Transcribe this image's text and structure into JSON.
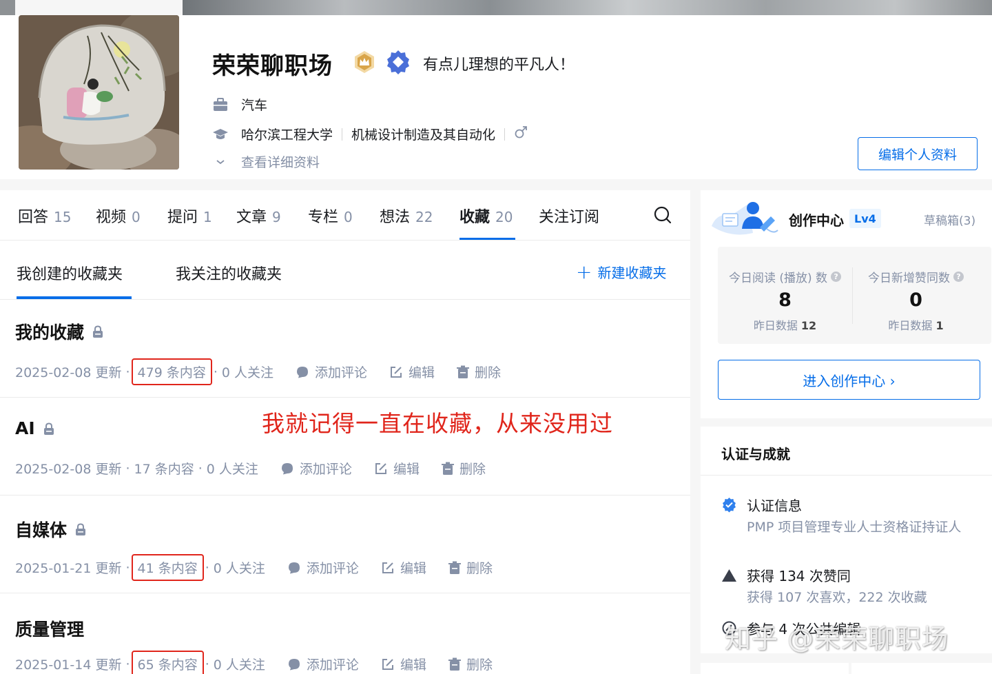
{
  "profile": {
    "name": "荣荣聊职场",
    "headline": "有点儿理想的平凡人！",
    "industry": "汽车",
    "school": "哈尔滨工程大学",
    "major": "机械设计制造及其自动化",
    "gender_icon": "male-icon",
    "detail_link": "查看详细资料",
    "edit_button": "编辑个人资料"
  },
  "tabs": [
    {
      "label": "回答",
      "count": "15"
    },
    {
      "label": "视频",
      "count": "0"
    },
    {
      "label": "提问",
      "count": "1"
    },
    {
      "label": "文章",
      "count": "9"
    },
    {
      "label": "专栏",
      "count": "0"
    },
    {
      "label": "想法",
      "count": "22"
    },
    {
      "label": "收藏",
      "count": "20",
      "active": true
    },
    {
      "label": "关注订阅",
      "count": ""
    }
  ],
  "subtabs": {
    "mine": "我创建的收藏夹",
    "followed": "我关注的收藏夹",
    "new_folder": "新建收藏夹"
  },
  "actions": {
    "comment": "添加评论",
    "edit": "编辑",
    "delete": "删除"
  },
  "collections": [
    {
      "title": "我的收藏",
      "updated": "2025-02-08 更新",
      "count": "479 条内容",
      "followers": "0 人关注",
      "locked": true,
      "highlighted": true
    },
    {
      "title": "AI",
      "updated": "2025-02-08 更新",
      "count": "17 条内容",
      "followers": "0 人关注",
      "locked": true,
      "highlighted": false
    },
    {
      "title": "自媒体",
      "updated": "2025-01-21 更新",
      "count": "41 条内容",
      "followers": "0 人关注",
      "locked": true,
      "highlighted": true
    },
    {
      "title": "质量管理",
      "updated": "2025-01-14 更新",
      "count": "65 条内容",
      "followers": "0 人关注",
      "locked": false,
      "highlighted": true
    }
  ],
  "annotation": "我就记得一直在收藏，从来没用过",
  "creator": {
    "title": "创作中心",
    "level": "Lv4",
    "drafts": "草稿箱(3)",
    "reads_label": "今日阅读 (播放) 数",
    "reads_value": "8",
    "reads_yesterday_label": "昨日数据",
    "reads_yesterday": "12",
    "likes_label": "今日新增赞同数",
    "likes_value": "0",
    "likes_yesterday_label": "昨日数据",
    "likes_yesterday": "1",
    "enter_button": "进入创作中心 ›"
  },
  "achievements": {
    "title": "认证与成就",
    "cert_label": "认证信息",
    "cert_detail": "PMP 项目管理专业人士资格证持证人",
    "likes_line": "获得 134 次赞同",
    "likes_detail": "获得 107 次喜欢，222 次收藏",
    "edit_line": "参与 4 次公共编辑"
  },
  "watermark": "知乎 @荣荣聊职场",
  "colors": {
    "brand_blue": "#056de8",
    "annotation_red": "#e0251b",
    "muted_text": "#8590a6"
  }
}
